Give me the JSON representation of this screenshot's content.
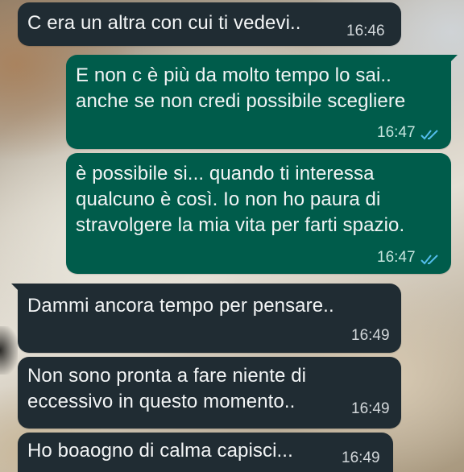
{
  "theme": {
    "incoming_bubble_color": "#202c33",
    "outgoing_bubble_color": "#005c4b",
    "read_tick_color": "#53bdeb"
  },
  "messages": [
    {
      "direction": "incoming",
      "text": "C era un altra con cui ti vedevi..",
      "time": "16:46"
    },
    {
      "direction": "outgoing",
      "text": "E non c è più da molto tempo lo sai..\nanche se non credi possibile scegliere",
      "time": "16:47",
      "status": "read",
      "status_icon": "double-check-icon"
    },
    {
      "direction": "outgoing",
      "text": "è possibile si... quando ti interessa\nqualcuno è così. Io non ho paura di\nstravolgere la mia vita per farti spazio.",
      "time": "16:47",
      "status": "read",
      "status_icon": "double-check-icon"
    },
    {
      "direction": "incoming",
      "text": "Dammi ancora tempo per pensare..",
      "time": "16:49"
    },
    {
      "direction": "incoming",
      "text": "Non sono pronta a fare niente di\neccessivo in questo momento..",
      "time": "16:49"
    },
    {
      "direction": "incoming",
      "text": "Ho boaogno di calma capisci...",
      "time": "16:49"
    }
  ]
}
